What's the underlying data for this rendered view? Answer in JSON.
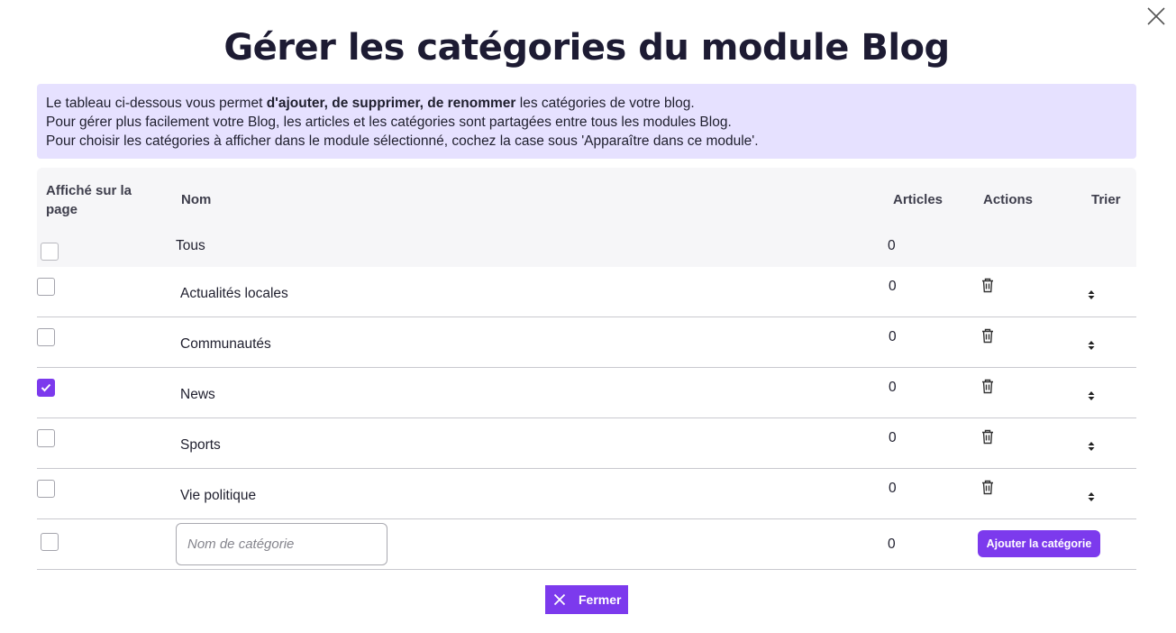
{
  "dialog": {
    "title": "Gérer les catégories du module Blog",
    "close_icon": "close-icon"
  },
  "info": {
    "line1_prefix": "Le tableau ci-dessous vous permet ",
    "line1_bold": "d'ajouter, de supprimer, de renommer",
    "line1_suffix": " les catégories de votre blog.",
    "line2": "Pour gérer plus facilement votre Blog, les articles et les catégories sont partagées entre tous les modules Blog.",
    "line3": "Pour choisir les catégories à afficher dans le module sélectionné, cochez la case sous 'Apparaître dans ce module'."
  },
  "table": {
    "headers": {
      "displayed_line1": "Affiché sur la",
      "displayed_line2": "page",
      "name": "Nom",
      "articles": "Articles",
      "actions": "Actions",
      "sort": "Trier"
    },
    "all_row": {
      "name": "Tous",
      "articles": "0",
      "checked": false
    },
    "rows": [
      {
        "name": "Actualités locales",
        "articles": "0",
        "checked": false
      },
      {
        "name": "Communautés",
        "articles": "0",
        "checked": false
      },
      {
        "name": "News",
        "articles": "0",
        "checked": true
      },
      {
        "name": "Sports",
        "articles": "0",
        "checked": false
      },
      {
        "name": "Vie politique",
        "articles": "0",
        "checked": false
      }
    ],
    "new_row": {
      "placeholder": "Nom de catégorie",
      "articles": "0",
      "add_label": "Ajouter la catégorie",
      "checked": false
    }
  },
  "footer": {
    "close_label": "Fermer"
  },
  "colors": {
    "accent": "#7c3aed",
    "info_bg": "#e6e1ff",
    "header_bg": "#f6f6f8"
  }
}
